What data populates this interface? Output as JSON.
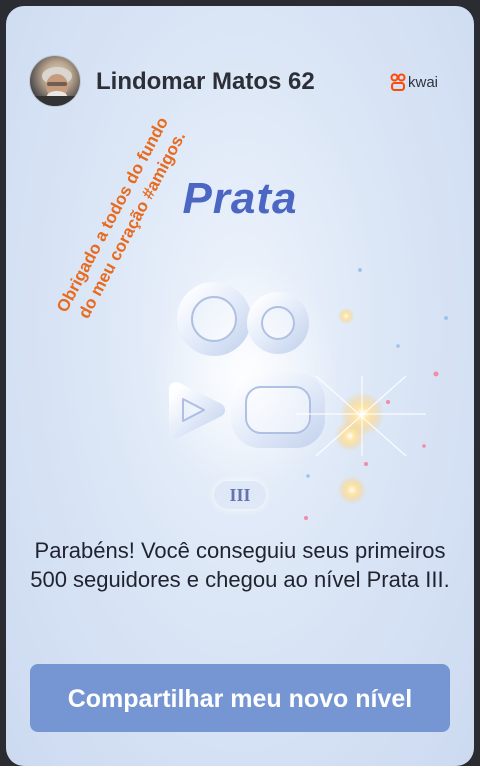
{
  "header": {
    "username": "Lindomar Matos 62",
    "brand": "kwai"
  },
  "level": {
    "name": "Prata",
    "tier": "III"
  },
  "overlay_text": {
    "line1": "Obrigado a todos do fundo",
    "line2": "do meu coração #amigos."
  },
  "message": "Parabéns! Você conseguiu seus primeiros 500 seguidores e chegou ao nível Prata III.",
  "share_button": "Compartilhar meu novo nível",
  "colors": {
    "title": "#4c66c4",
    "button": "#7596d3",
    "overlay_text": "#e86a1e",
    "brand_logo": "#ff4906"
  }
}
